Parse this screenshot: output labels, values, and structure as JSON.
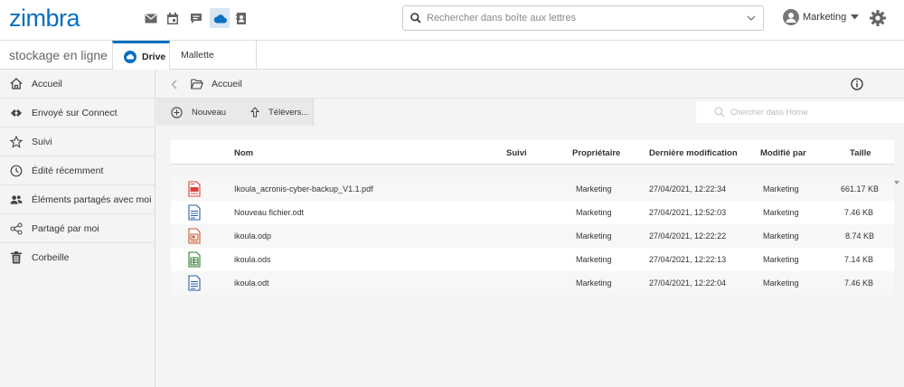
{
  "header": {
    "logo": "zimbra",
    "search_placeholder": "Rechercher dans boîte aux lettres",
    "user_name": "Marketing"
  },
  "tabs": {
    "app_title": "stockage en ligne",
    "drive": "Drive",
    "mallette": "Mallette"
  },
  "sidebar": {
    "items": [
      {
        "label": "Accueil",
        "icon": "home-icon"
      },
      {
        "label": "Envoyé sur Connect",
        "icon": "connect-icon"
      },
      {
        "label": "Suivi",
        "icon": "star-icon"
      },
      {
        "label": "Édité récemment",
        "icon": "clock-icon"
      },
      {
        "label": "Éléments partagés avec moi",
        "icon": "users-icon"
      },
      {
        "label": "Partagé par moi",
        "icon": "share-icon"
      },
      {
        "label": "Corbeille",
        "icon": "trash-icon"
      }
    ]
  },
  "breadcrumb": {
    "current": "Accueil"
  },
  "toolbar": {
    "new_label": "Nouveau",
    "upload_label": "Télévers...",
    "search_placeholder": "Chercher dans Home"
  },
  "table": {
    "columns": {
      "name": "Nom",
      "follow": "Suivi",
      "owner": "Propriétaire",
      "modified": "Dernière modification",
      "modified_by": "Modifié par",
      "size": "Taille"
    },
    "rows": [
      {
        "name": "Ikoula_acronis-cyber-backup_V1.1.pdf",
        "type": "pdf",
        "owner": "Marketing",
        "modified": "27/04/2021, 12:22:34",
        "modified_by": "Marketing",
        "size": "661.17 KB"
      },
      {
        "name": "Nouveau fichier.odt",
        "type": "odt",
        "owner": "Marketing",
        "modified": "27/04/2021, 12:52:03",
        "modified_by": "Marketing",
        "size": "7.46 KB"
      },
      {
        "name": "ikoula.odp",
        "type": "odp",
        "owner": "Marketing",
        "modified": "27/04/2021, 12:22:22",
        "modified_by": "Marketing",
        "size": "8.74 KB"
      },
      {
        "name": "ikoula.ods",
        "type": "ods",
        "owner": "Marketing",
        "modified": "27/04/2021, 12:22:13",
        "modified_by": "Marketing",
        "size": "7.14 KB"
      },
      {
        "name": "ikoula.odt",
        "type": "odt",
        "owner": "Marketing",
        "modified": "27/04/2021, 12:22:04",
        "modified_by": "Marketing",
        "size": "7.46 KB"
      }
    ]
  },
  "colors": {
    "brand": "#0b70bd",
    "pdf": "#d9413b",
    "odt": "#2c5da8",
    "odp": "#c9552d",
    "ods": "#2f7d32"
  }
}
